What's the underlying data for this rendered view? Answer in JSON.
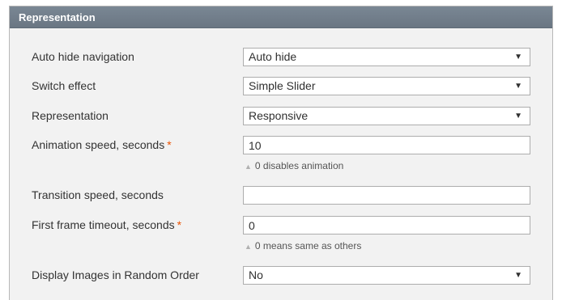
{
  "panel": {
    "title": "Representation"
  },
  "fields": {
    "auto_hide_navigation": {
      "label": "Auto hide navigation",
      "value": "Auto hide"
    },
    "switch_effect": {
      "label": "Switch effect",
      "value": "Simple Slider"
    },
    "representation": {
      "label": "Representation",
      "value": "Responsive"
    },
    "animation_speed": {
      "label": "Animation speed, seconds",
      "required_mark": "*",
      "value": "10",
      "hint": "0 disables animation"
    },
    "transition_speed": {
      "label": "Transition speed, seconds",
      "value": ""
    },
    "first_frame_timeout": {
      "label": "First frame timeout, seconds",
      "required_mark": "*",
      "value": "0",
      "hint": "0 means same as others"
    },
    "random_order": {
      "label": "Display Images in Random Order",
      "value": "No"
    }
  },
  "icons": {
    "dropdown": "chevron-down-icon",
    "hint": "triangle-up-icon"
  },
  "colors": {
    "header_bg": "#7a8794",
    "panel_bg": "#f2f2f2",
    "required": "#eb5202"
  }
}
